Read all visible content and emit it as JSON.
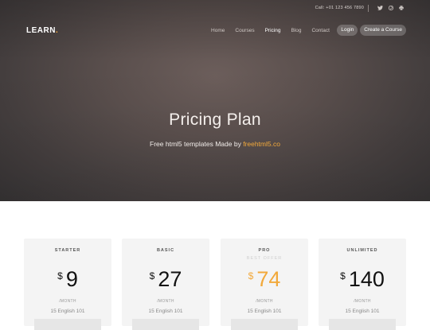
{
  "topbar": {
    "call": "Call: +01 123 456 7890",
    "social_icons": [
      "twitter-icon",
      "pinterest-icon",
      "printer-icon"
    ]
  },
  "nav": {
    "logo": "LEARN",
    "logo_dot": ".",
    "links": [
      "Home",
      "Courses",
      "Pricing",
      "Blog",
      "Contact"
    ],
    "active": "Pricing",
    "login": "Login",
    "cta": "Create a Course"
  },
  "hero": {
    "title": "Pricing Plan",
    "subtitle": "Free html5 templates Made by ",
    "subtitle_link": "freehtml5.co"
  },
  "plans": [
    {
      "name": "STARTER",
      "tag": "",
      "currency": "$",
      "price": "9",
      "period": "/MONTH",
      "feature": "15 English 101"
    },
    {
      "name": "BASIC",
      "tag": "",
      "currency": "$",
      "price": "27",
      "period": "/MONTH",
      "feature": "15 English 101"
    },
    {
      "name": "PRO",
      "tag": "BEST OFFER",
      "currency": "$",
      "price": "74",
      "period": "/MONTH",
      "feature": "15 English 101"
    },
    {
      "name": "UNLIMITED",
      "tag": "",
      "currency": "$",
      "price": "140",
      "period": "/MONTH",
      "feature": "15 English 101"
    }
  ],
  "colors": {
    "accent": "#f2a93b",
    "card_bg": "#f4f4f4"
  }
}
